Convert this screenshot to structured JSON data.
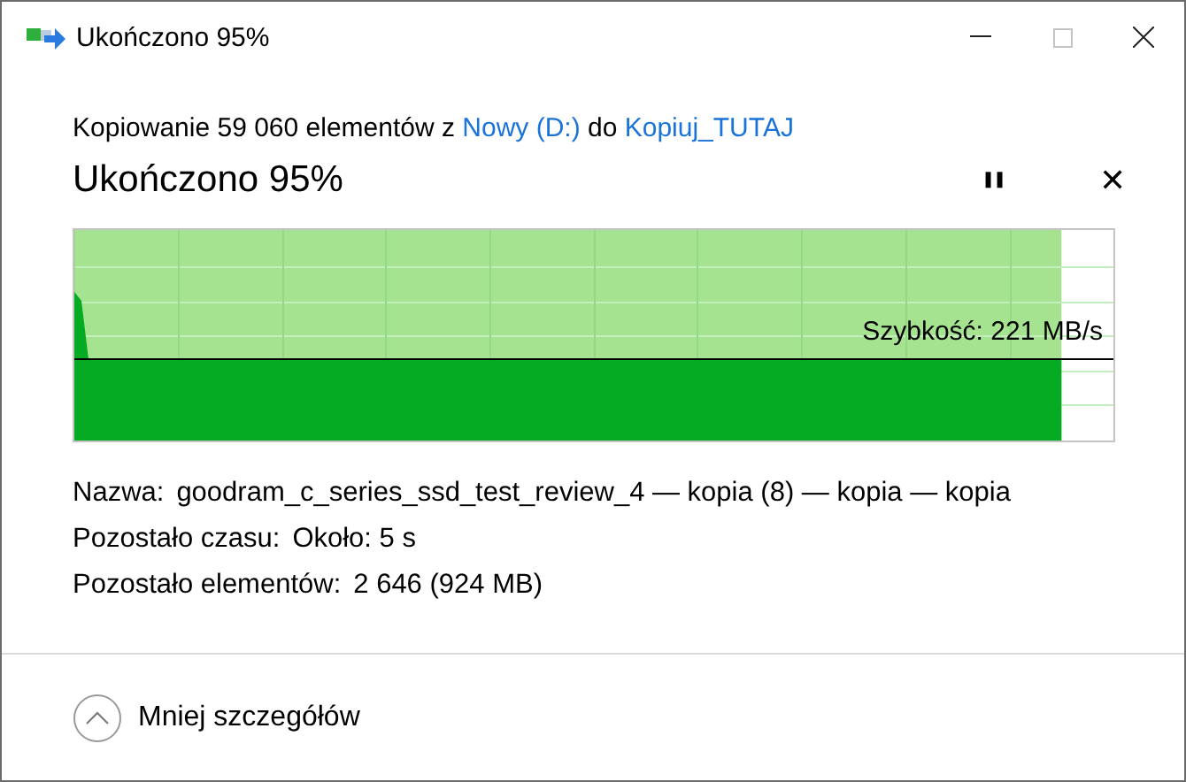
{
  "window": {
    "title": "Ukończono 95%",
    "controls": [
      {
        "kind": "minimize",
        "disabled": false
      },
      {
        "kind": "maximize",
        "disabled": true
      },
      {
        "kind": "close",
        "disabled": false
      }
    ]
  },
  "message": {
    "prefix": "Kopiowanie 59 060 elementów z",
    "source": "Nowy (D:)",
    "middle": "do",
    "destination": "Kopiuj_TUTAJ"
  },
  "heading": "Ukończono 95%",
  "actions": [
    {
      "kind": "pause",
      "label": "❚❚"
    },
    {
      "kind": "cancel",
      "label": "✕"
    }
  ],
  "graph": {
    "level": 0.95,
    "speed": "Szybkość: 221 MB/s"
  },
  "details": [
    {
      "label": "Nazwa:",
      "value": "goodram_c_series_ssd_test_review_4 — kopia (8) — kopia — kopia"
    },
    {
      "label": "Pozostało czasu:",
      "value": "Około: 5 s"
    },
    {
      "label": "Pozostało elementów:",
      "value": "2 646 (924 MB)"
    }
  ],
  "footer": {
    "label": "Mniej szczegółów",
    "expanded": true
  }
}
